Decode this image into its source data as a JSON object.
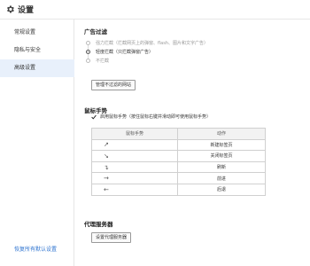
{
  "window": {
    "title": "设置",
    "title_icon": "gear-icon"
  },
  "sidebar": {
    "items": [
      {
        "label": "常规设置",
        "active": false
      },
      {
        "label": "隐私与安全",
        "active": false
      },
      {
        "label": "高级设置",
        "active": true
      }
    ],
    "restore_defaults": "恢复所有默认设置"
  },
  "ad_filter": {
    "title": "广告过滤",
    "options": [
      {
        "label": "强力拦截（拦截网页上的弹窗、flash、图片和文字广告）",
        "selected": false
      },
      {
        "label": "轻度拦截（只拦截弹窗广告）",
        "selected": true
      },
      {
        "label": "不拦截",
        "selected": false
      }
    ],
    "manage_button": "管理不过滤的网站"
  },
  "mouse_gesture": {
    "title": "鼠标手势",
    "enable_label": "启用鼠标手势（按住鼠标右键并滑动即可使用鼠标手势）",
    "enabled": true,
    "table": {
      "headers": [
        "鼠标手势",
        "动作"
      ],
      "rows": [
        {
          "gesture": "↗",
          "action": "新建标签页"
        },
        {
          "gesture": "↘",
          "action": "关闭标签页"
        },
        {
          "gesture": "↴",
          "action": "刷新"
        },
        {
          "gesture": "→",
          "action": "前进"
        },
        {
          "gesture": "←",
          "action": "后退"
        }
      ]
    }
  },
  "proxy": {
    "title": "代理服务器",
    "settings_button": "设置代理服务器"
  }
}
